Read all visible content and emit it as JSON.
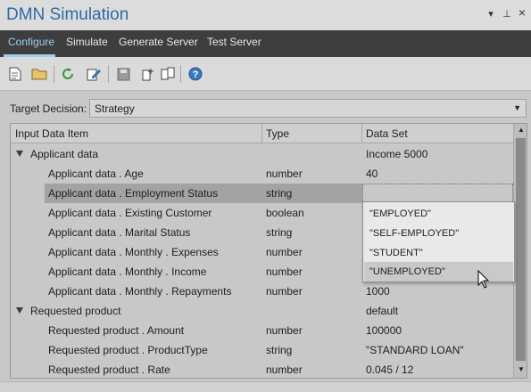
{
  "window": {
    "title": "DMN Simulation",
    "controls": {
      "dropdown_icon": "▾",
      "pin_icon": "⊥",
      "close_icon": "×"
    }
  },
  "tabs": [
    {
      "label": "Configure",
      "active": true
    },
    {
      "label": "Simulate",
      "active": false
    },
    {
      "label": "Generate Server",
      "active": false
    },
    {
      "label": "Test Server",
      "active": false
    }
  ],
  "toolbar": {
    "buttons": [
      "new-icon",
      "open-folder-icon",
      "refresh-icon",
      "edit-icon",
      "save-icon",
      "copy-icon",
      "paste-icon",
      "help-icon"
    ]
  },
  "target": {
    "label": "Target Decision:",
    "value": "Strategy"
  },
  "grid": {
    "columns": [
      "Input Data Item",
      "Type",
      "Data Set"
    ],
    "rows": [
      {
        "name": "Applicant data",
        "type": "",
        "value": "Income 5000",
        "group": true
      },
      {
        "name": "Applicant data . Age",
        "type": "number",
        "value": "40",
        "group": false
      },
      {
        "name": "Applicant data . Employment Status",
        "type": "string",
        "value": "",
        "group": false,
        "selected": true
      },
      {
        "name": "Applicant data . Existing Customer",
        "type": "boolean",
        "value": "",
        "group": false
      },
      {
        "name": "Applicant data . Marital Status",
        "type": "string",
        "value": "",
        "group": false
      },
      {
        "name": "Applicant data . Monthly . Expenses",
        "type": "number",
        "value": "",
        "group": false
      },
      {
        "name": "Applicant data . Monthly . Income",
        "type": "number",
        "value": "",
        "group": false
      },
      {
        "name": "Applicant data . Monthly . Repayments",
        "type": "number",
        "value": "1000",
        "group": false
      },
      {
        "name": "Requested product",
        "type": "",
        "value": "default",
        "group": true
      },
      {
        "name": "Requested product . Amount",
        "type": "number",
        "value": "100000",
        "group": false
      },
      {
        "name": "Requested product . ProductType",
        "type": "string",
        "value": "\"STANDARD LOAN\"",
        "group": false
      },
      {
        "name": "Requested product . Rate",
        "type": "number",
        "value": "0.045 / 12",
        "group": false
      }
    ]
  },
  "dropdown": {
    "options": [
      "\"EMPLOYED\"",
      "\"SELF-EMPLOYED\"",
      "\"STUDENT\"",
      "\"UNEMPLOYED\""
    ],
    "hovered": "\"UNEMPLOYED\""
  },
  "scrollbar": {
    "up_icon": "▲",
    "down_icon": "▼"
  },
  "colors": {
    "title": "#2d6aa8",
    "tab_active": "#9ccef2",
    "tabbar_bg": "#3e3e3e"
  }
}
